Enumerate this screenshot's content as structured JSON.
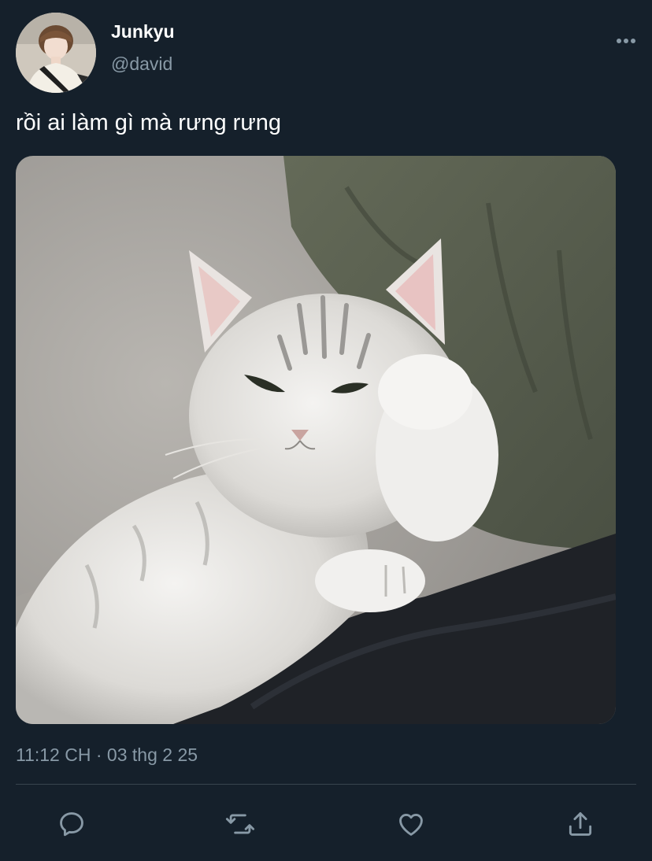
{
  "author": {
    "display_name": "Junkyu",
    "handle": "@david"
  },
  "tweet": {
    "text": "rồi ai làm gì mà rưng rưng",
    "time": "11:12 CH",
    "separator": "·",
    "date": "03 thg 2 25"
  },
  "icons": {
    "more": "more-horizontal-icon",
    "reply": "reply-icon",
    "retweet": "retweet-icon",
    "like": "like-heart-icon",
    "share": "share-icon"
  },
  "colors": {
    "background": "#15202b",
    "primary_text": "#ffffff",
    "secondary_text": "#8899a6",
    "divider": "#38444d"
  }
}
